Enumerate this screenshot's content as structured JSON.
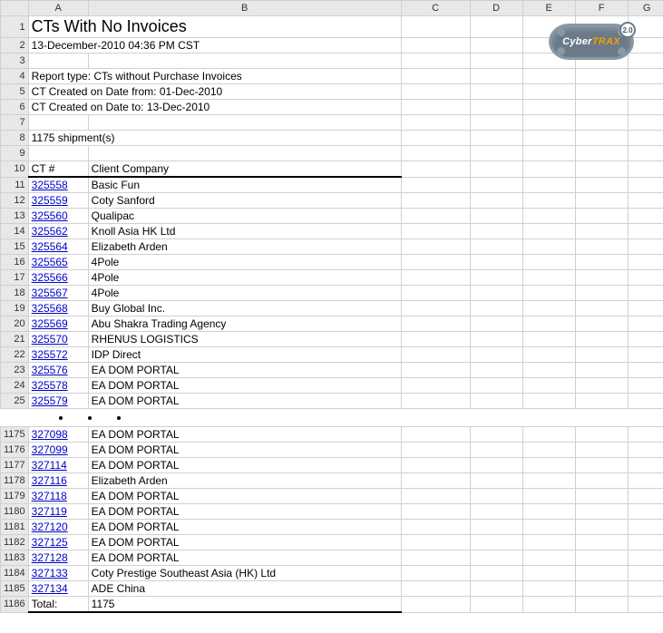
{
  "columns": [
    "",
    "A",
    "B",
    "C",
    "D",
    "E",
    "F",
    "G"
  ],
  "header": {
    "title": "CTs With No Invoices",
    "timestamp": "13-December-2010 04:36 PM CST",
    "report_type": "Report type: CTs without Purchase Invoices",
    "date_from": "CT Created on Date from: 01-Dec-2010",
    "date_to": "CT Created on Date to: 13-Dec-2010",
    "shipment_count": "1175 shipment(s)"
  },
  "logo": {
    "text_left": "Cyber",
    "text_right": "TRAX",
    "badge": "2.0"
  },
  "table_headers": {
    "ct": "CT #",
    "client": "Client Company"
  },
  "rows_top": [
    {
      "row": 11,
      "ct": "325558",
      "client": "Basic Fun"
    },
    {
      "row": 12,
      "ct": "325559",
      "client": "Coty Sanford"
    },
    {
      "row": 13,
      "ct": "325560",
      "client": "Qualipac"
    },
    {
      "row": 14,
      "ct": "325562",
      "client": "Knoll Asia HK Ltd"
    },
    {
      "row": 15,
      "ct": "325564",
      "client": "Elizabeth Arden"
    },
    {
      "row": 16,
      "ct": "325565",
      "client": "4Pole"
    },
    {
      "row": 17,
      "ct": "325566",
      "client": "4Pole"
    },
    {
      "row": 18,
      "ct": "325567",
      "client": "4Pole"
    },
    {
      "row": 19,
      "ct": "325568",
      "client": "Buy Global Inc."
    },
    {
      "row": 20,
      "ct": "325569",
      "client": "Abu Shakra Trading Agency"
    },
    {
      "row": 21,
      "ct": "325570",
      "client": "RHENUS LOGISTICS"
    },
    {
      "row": 22,
      "ct": "325572",
      "client": "IDP Direct"
    },
    {
      "row": 23,
      "ct": "325576",
      "client": "EA DOM PORTAL"
    },
    {
      "row": 24,
      "ct": "325578",
      "client": "EA DOM PORTAL"
    },
    {
      "row": 25,
      "ct": "325579",
      "client": "EA DOM PORTAL"
    }
  ],
  "rows_bottom": [
    {
      "row": 1175,
      "ct": "327098",
      "client": "EA DOM PORTAL"
    },
    {
      "row": 1176,
      "ct": "327099",
      "client": "EA DOM PORTAL"
    },
    {
      "row": 1177,
      "ct": "327114",
      "client": "EA DOM PORTAL"
    },
    {
      "row": 1178,
      "ct": "327116",
      "client": "Elizabeth Arden"
    },
    {
      "row": 1179,
      "ct": "327118",
      "client": "EA DOM PORTAL"
    },
    {
      "row": 1180,
      "ct": "327119",
      "client": "EA DOM PORTAL"
    },
    {
      "row": 1181,
      "ct": "327120",
      "client": "EA DOM PORTAL"
    },
    {
      "row": 1182,
      "ct": "327125",
      "client": "EA DOM PORTAL"
    },
    {
      "row": 1183,
      "ct": "327128",
      "client": "EA DOM PORTAL"
    },
    {
      "row": 1184,
      "ct": "327133",
      "client": "Coty Prestige Southeast Asia (HK) Ltd"
    },
    {
      "row": 1185,
      "ct": "327134",
      "client": "ADE China"
    }
  ],
  "total": {
    "row": 1186,
    "label": "Total:",
    "value": "1175"
  }
}
